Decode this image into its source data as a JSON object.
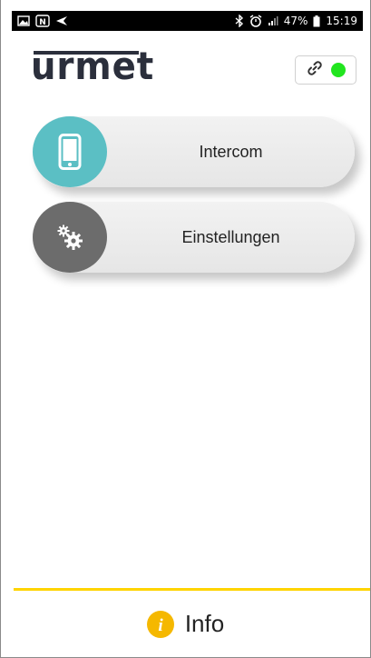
{
  "status_bar": {
    "battery": "47%",
    "time": "15:19",
    "icons": [
      "image-icon",
      "nfc-icon",
      "navigation-icon",
      "bluetooth-icon",
      "alarm-icon",
      "signal-icon",
      "battery-icon"
    ]
  },
  "header": {
    "logo": "urmet",
    "connection": {
      "icon": "link-icon",
      "status_color": "#22e51f"
    }
  },
  "menu": {
    "items": [
      {
        "label": "Intercom",
        "icon": "smartphone-icon",
        "color": "#5bbfc4"
      },
      {
        "label": "Einstellungen",
        "icon": "gears-icon",
        "color": "#6c6c6c"
      }
    ]
  },
  "footer": {
    "info_label": "Info",
    "info_icon": "info-icon",
    "accent": "#ffd400"
  }
}
